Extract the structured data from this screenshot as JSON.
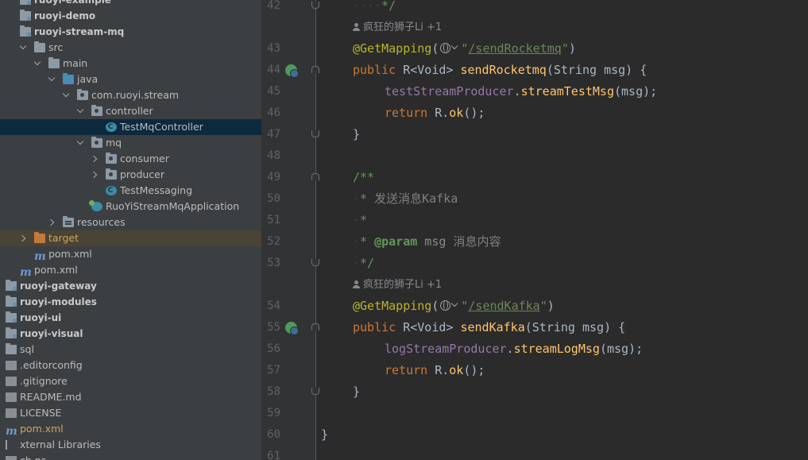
{
  "project_tree": [
    {
      "label": "ruoyi-example",
      "icon": "module-folder-icon",
      "indent": 0,
      "style": "bold"
    },
    {
      "label": "ruoyi-demo",
      "icon": "module-folder-icon",
      "indent": 0,
      "style": "bold"
    },
    {
      "label": "ruoyi-stream-mq",
      "icon": "module-folder-icon",
      "indent": 0,
      "style": "bold"
    },
    {
      "label": "src",
      "icon": "folder-icon",
      "indent": 1,
      "expanded": true
    },
    {
      "label": "main",
      "icon": "folder-icon",
      "indent": 2,
      "expanded": true
    },
    {
      "label": "java",
      "icon": "source-folder-icon",
      "indent": 3,
      "expanded": true
    },
    {
      "label": "com.ruoyi.stream",
      "icon": "package-icon",
      "indent": 4,
      "expanded": true
    },
    {
      "label": "controller",
      "icon": "package-icon",
      "indent": 5,
      "expanded": true
    },
    {
      "label": "TestMqController",
      "icon": "class-icon",
      "indent": 6,
      "selected": true
    },
    {
      "label": "mq",
      "icon": "package-icon",
      "indent": 5,
      "expanded": true
    },
    {
      "label": "consumer",
      "icon": "package-icon",
      "indent": 6,
      "expanded": false
    },
    {
      "label": "producer",
      "icon": "package-icon",
      "indent": 6,
      "expanded": false
    },
    {
      "label": "TestMessaging",
      "icon": "class-icon",
      "indent": 6
    },
    {
      "label": "RuoYiStreamMqApplication",
      "icon": "spring-app-icon",
      "indent": 5
    },
    {
      "label": "resources",
      "icon": "resources-folder-icon",
      "indent": 3,
      "expanded": false
    },
    {
      "label": "target",
      "icon": "target-folder-icon",
      "indent": 1,
      "expanded": false,
      "style": "orange",
      "highlight": true
    },
    {
      "label": "pom.xml",
      "icon": "maven-icon",
      "indent": 1
    },
    {
      "label": "pom.xml",
      "icon": "maven-icon",
      "indent": 0
    },
    {
      "label": "ruoyi-gateway",
      "icon": "module-folder-icon",
      "indent": -1,
      "style": "bold"
    },
    {
      "label": "ruoyi-modules",
      "icon": "module-folder-icon",
      "indent": -1,
      "style": "bold"
    },
    {
      "label": "ruoyi-ui",
      "icon": "module-folder-icon",
      "indent": -1,
      "style": "bold"
    },
    {
      "label": "ruoyi-visual",
      "icon": "module-folder-icon",
      "indent": -1,
      "style": "bold"
    },
    {
      "label": "sql",
      "icon": "folder-icon",
      "indent": -1
    },
    {
      "label": ".editorconfig",
      "icon": "file-icon",
      "indent": -1
    },
    {
      "label": ".gitignore",
      "icon": "file-icon",
      "indent": -1
    },
    {
      "label": "README.md",
      "icon": "file-icon",
      "indent": -1
    },
    {
      "label": "LICENSE",
      "icon": "file-icon",
      "indent": -1
    },
    {
      "label": "pom.xml",
      "icon": "maven-icon",
      "indent": -1,
      "style": "orange"
    },
    {
      "label": "xternal Libraries",
      "icon": "libraries-icon",
      "indent": -1
    },
    {
      "label": "ch              ns",
      "icon": "scratch-icon",
      "indent": -1
    }
  ],
  "author_hint": "疯狂的狮子Li +1",
  "editor_lines": [
    {
      "kind": "line",
      "num": "42",
      "fold": "up",
      "tokens": [
        [
          "dot",
          "····"
        ],
        [
          "cm",
          "*/"
        ]
      ],
      "indent": 1
    },
    {
      "kind": "author"
    },
    {
      "kind": "line",
      "num": "43",
      "tokens": [
        [
          "ann",
          "@GetMapping"
        ],
        [
          "meth",
          "("
        ],
        [
          "inj",
          ""
        ],
        [
          "str",
          "\""
        ],
        [
          "url",
          "/sendRocketmq"
        ],
        [
          "str",
          "\""
        ],
        [
          "meth",
          ")"
        ]
      ],
      "indent": 1
    },
    {
      "kind": "line",
      "num": "44",
      "gutter_icon": true,
      "fold": "down",
      "tokens": [
        [
          "kw",
          "public "
        ],
        [
          "meth",
          "R<Void> "
        ],
        [
          "fn",
          "sendRocketmq"
        ],
        [
          "meth",
          "(String msg) {"
        ]
      ],
      "indent": 1
    },
    {
      "kind": "line",
      "num": "45",
      "tokens": [
        [
          "fld",
          "testStreamProducer"
        ],
        [
          "meth",
          "."
        ],
        [
          "call",
          "streamTestMsg"
        ],
        [
          "meth",
          "(msg);"
        ]
      ],
      "indent": 2
    },
    {
      "kind": "line",
      "num": "46",
      "tokens": [
        [
          "kw",
          "return "
        ],
        [
          "meth",
          "R."
        ],
        [
          "call",
          "ok"
        ],
        [
          "meth",
          "();"
        ]
      ],
      "indent": 2
    },
    {
      "kind": "line",
      "num": "47",
      "fold": "up",
      "tokens": [
        [
          "meth",
          "}"
        ]
      ],
      "indent": 1
    },
    {
      "kind": "line",
      "num": "48",
      "tokens": [],
      "indent": 0
    },
    {
      "kind": "line",
      "num": "49",
      "fold": "down",
      "tokens": [
        [
          "cm",
          "/**"
        ]
      ],
      "indent": 1
    },
    {
      "kind": "line",
      "num": "50",
      "tokens": [
        [
          "dot",
          "·"
        ],
        [
          "cm",
          "* "
        ],
        [
          "cmg",
          "发送消息Kafka"
        ]
      ],
      "indent": 1
    },
    {
      "kind": "line",
      "num": "51",
      "tokens": [
        [
          "dot",
          "·"
        ],
        [
          "cm",
          "*"
        ]
      ],
      "indent": 1
    },
    {
      "kind": "line",
      "num": "52",
      "tokens": [
        [
          "dot",
          "·"
        ],
        [
          "cm",
          "* "
        ],
        [
          "tag",
          "@param"
        ],
        [
          "pm",
          " msg "
        ],
        [
          "cmg",
          "消息内容"
        ]
      ],
      "indent": 1
    },
    {
      "kind": "line",
      "num": "53",
      "fold": "up",
      "tokens": [
        [
          "dot",
          "·"
        ],
        [
          "cm",
          "*/"
        ]
      ],
      "indent": 1
    },
    {
      "kind": "author"
    },
    {
      "kind": "line",
      "num": "54",
      "tokens": [
        [
          "ann",
          "@GetMapping"
        ],
        [
          "meth",
          "("
        ],
        [
          "inj",
          ""
        ],
        [
          "str",
          "\""
        ],
        [
          "url",
          "/sendKafka"
        ],
        [
          "str",
          "\""
        ],
        [
          "meth",
          ")"
        ]
      ],
      "indent": 1
    },
    {
      "kind": "line",
      "num": "55",
      "gutter_icon": true,
      "fold": "down",
      "tokens": [
        [
          "kw",
          "public "
        ],
        [
          "meth",
          "R<Void> "
        ],
        [
          "fn",
          "sendKafka"
        ],
        [
          "meth",
          "(String msg) {"
        ]
      ],
      "indent": 1
    },
    {
      "kind": "line",
      "num": "56",
      "tokens": [
        [
          "fld",
          "logStreamProducer"
        ],
        [
          "meth",
          "."
        ],
        [
          "call",
          "streamLogMsg"
        ],
        [
          "meth",
          "(msg);"
        ]
      ],
      "indent": 2
    },
    {
      "kind": "line",
      "num": "57",
      "tokens": [
        [
          "kw",
          "return "
        ],
        [
          "meth",
          "R."
        ],
        [
          "call",
          "ok"
        ],
        [
          "meth",
          "();"
        ]
      ],
      "indent": 2
    },
    {
      "kind": "line",
      "num": "58",
      "fold": "up",
      "tokens": [
        [
          "meth",
          "}"
        ]
      ],
      "indent": 1
    },
    {
      "kind": "line",
      "num": "59",
      "tokens": [],
      "indent": 0
    },
    {
      "kind": "line",
      "num": "60",
      "tokens": [
        [
          "meth",
          "}"
        ]
      ],
      "indent": 0
    },
    {
      "kind": "line",
      "num": "61",
      "tokens": [],
      "indent": 0
    }
  ],
  "colors": {
    "tree_background": "#3c3f41",
    "editor_background": "#2b2b2b",
    "selection": "#0d293e",
    "keyword": "#cc7832",
    "annotation": "#bbb529",
    "method_name": "#ffc66d",
    "string": "#6a8759",
    "field": "#9876aa",
    "doc_comment": "#629755"
  }
}
